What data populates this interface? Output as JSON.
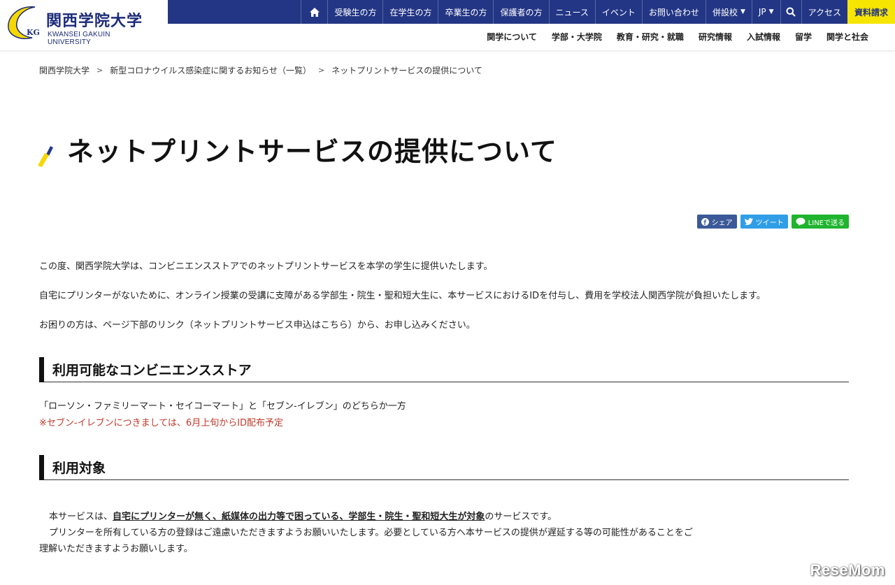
{
  "header": {
    "logo_ja": "関西学院大学",
    "logo_en": "KWANSEI GAKUIN UNIVERSITY",
    "logo_mark_text": "KG",
    "top_links": [
      "受験生の方",
      "在学生の方",
      "卒業生の方",
      "保護者の方",
      "ニュース",
      "イベント",
      "お問い合わせ"
    ],
    "dropdowns": [
      "併設校",
      "JP"
    ],
    "access": "アクセス",
    "request": "資料請求",
    "main_nav": [
      "関学について",
      "学部・大学院",
      "教育・研究・就職",
      "研究情報",
      "入試情報",
      "留学",
      "関学と社会"
    ],
    "colors": {
      "navy": "#233685",
      "yellow": "#f6e500"
    }
  },
  "breadcrumb": [
    "関西学院大学",
    "新型コロナウイルス感染症に関するお知らせ（一覧）",
    "ネットプリントサービスの提供について"
  ],
  "page_title": "ネットプリントサービスの提供について",
  "share": {
    "facebook": "シェア",
    "twitter": "ツイート",
    "line": "LINEで送る"
  },
  "intro": [
    "この度、関西学院大学は、コンビニエンスストアでのネットプリントサービスを本学の学生に提供いたします。",
    "自宅にプリンターがないために、オンライン授業の受講に支障がある学部生・院生・聖和短大生に、本サービスにおけるIDを付与し、費用を学校法人関西学院が負担いたします。",
    "お困りの方は、ページ下部のリンク（ネットプリントサービス申込はこちら）から、お申し込みください。"
  ],
  "sections": [
    {
      "heading": "利用可能なコンビニエンスストア",
      "text": "「ローソン・ファミリーマート・セイコーマート」と「セブン-イレブン」のどちらか一方",
      "note": "※セブン-イレブンにつきましては、6月上旬からID配布予定"
    },
    {
      "heading": "利用対象",
      "line1_prefix": "本サービスは、",
      "line1_emphasis": "自宅にプリンターが無く、紙媒体の出力等で困っている、学部生・院生・聖和短大生が対象",
      "line1_suffix": "のサービスです。",
      "line2": "プリンターを所有している方の登録はご遠慮いただきますようお願いいたします。必要としている方へ本サービスの提供が遅延する等の可能性があることをご",
      "line3": "理解いただきますようお願いします。"
    }
  ],
  "watermark": "ReseMom"
}
